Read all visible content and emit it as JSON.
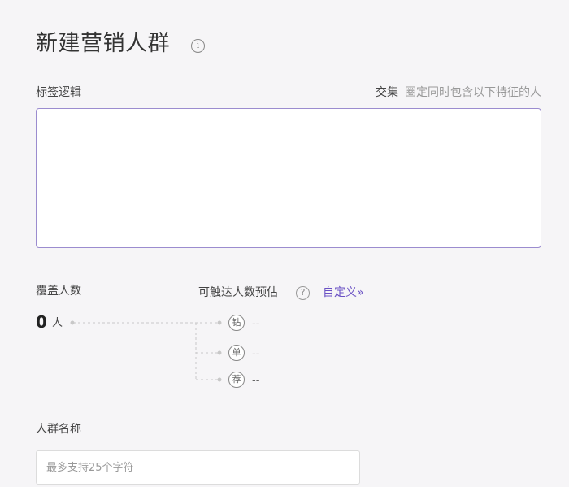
{
  "page": {
    "title": "新建营销人群",
    "info_icon": "info-icon"
  },
  "tag_logic": {
    "label": "标签逻辑",
    "mode_name": "交集",
    "mode_description": "圈定同时包含以下特征的人",
    "value": ""
  },
  "coverage": {
    "label": "覆盖人数",
    "count": "0",
    "unit": "人"
  },
  "reach": {
    "label": "可触达人数预估",
    "help_icon": "question-icon",
    "help_glyph": "?",
    "custom_link": "自定义»",
    "channels": [
      {
        "icon_text": "钻",
        "value": "--"
      },
      {
        "icon_text": "单",
        "value": "--"
      },
      {
        "icon_text": "荐",
        "value": "--"
      }
    ]
  },
  "audience_name": {
    "label": "人群名称",
    "placeholder": "最多支持25个字符",
    "value": ""
  },
  "colors": {
    "accent": "#6a51c4",
    "textarea_border": "#9b8ccf",
    "background": "#f6f5f7"
  }
}
